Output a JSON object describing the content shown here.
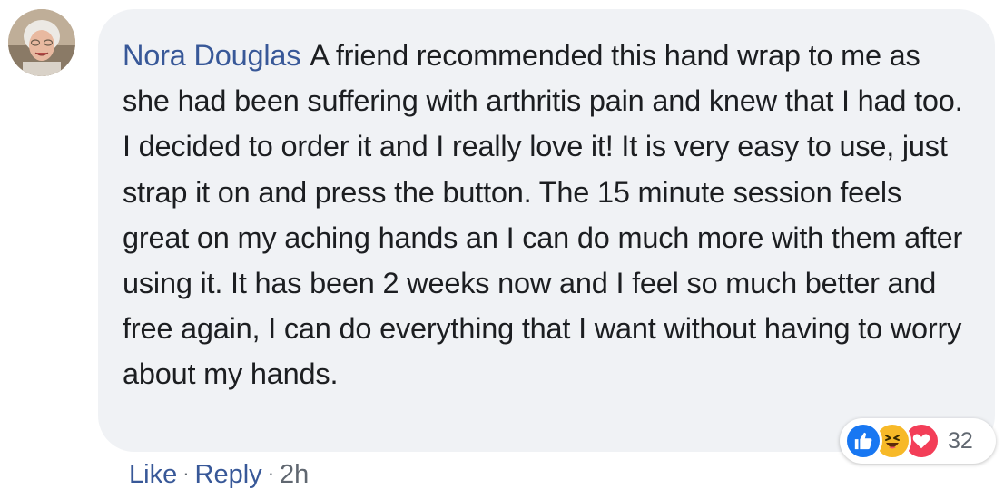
{
  "comment": {
    "author": "Nora Douglas",
    "text": "A friend recommended this hand wrap to me as she had been suffering with arthritis pain and knew that I had too. I decided to order it and I really love it! It is very easy to use, just strap it on and press the button. The 15 minute session feels great on my aching hands an I can do much more with them after using it. It has been 2 weeks now and I feel so much better and free again, I can do everything that I want without having to worry about my hands."
  },
  "reactions": {
    "icons": [
      "like-icon",
      "haha-icon",
      "love-icon"
    ],
    "count": "32"
  },
  "actions": {
    "like_label": "Like",
    "separator": "·",
    "reply_label": "Reply",
    "time": "2h"
  },
  "colors": {
    "bubble_bg": "#f0f2f5",
    "link_blue": "#385898",
    "text": "#1c1e21",
    "muted": "#606770",
    "like_blue": "#1877f2",
    "haha_yellow": "#f7b928",
    "love_red": "#f33e58"
  }
}
